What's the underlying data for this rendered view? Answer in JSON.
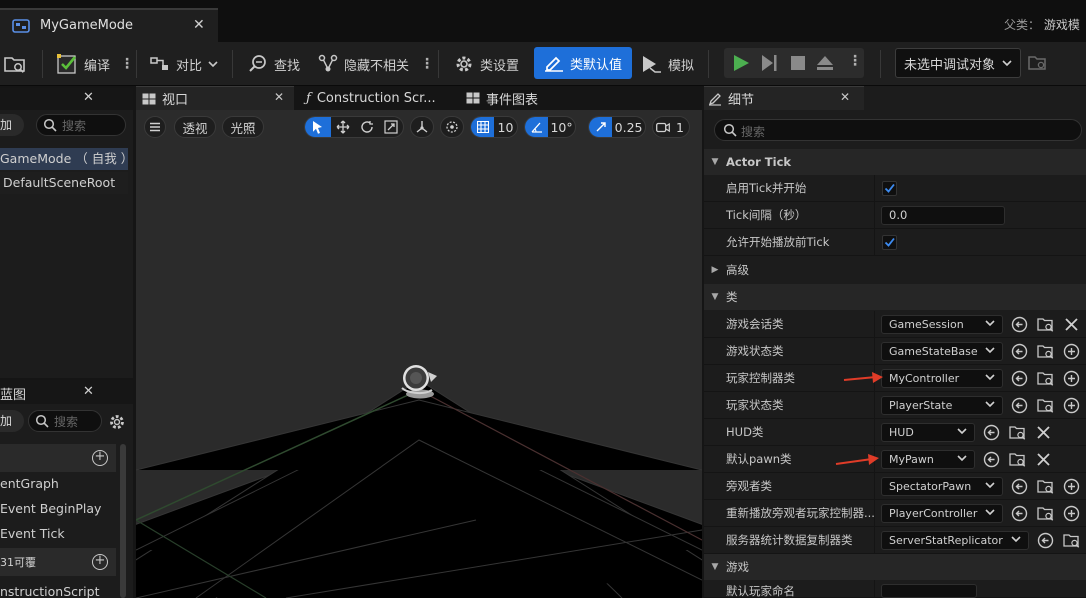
{
  "window": {
    "tab_title": "MyGameMode",
    "parent_label": "父类：",
    "parent_value": "游戏模"
  },
  "toolbar": {
    "compile": "编译",
    "diff": "对比",
    "find": "查找",
    "hide_unrelated": "隐藏不相关",
    "class_settings": "类设置",
    "class_defaults": "类默认值",
    "simulate": "模拟",
    "debug_target": "未选中调试对象"
  },
  "components": {
    "add_label": "加",
    "search_placeholder": "搜索",
    "root_item": "GameMode （ 自我 ）",
    "child_item": "DefaultSceneRoot"
  },
  "blueprint": {
    "title": "蓝图",
    "add_label": "加",
    "search_placeholder": "搜索",
    "items": [
      "entGraph",
      "Event BeginPlay",
      "Event Tick"
    ],
    "section2": "31可覆",
    "construction_item": "nstructionScript"
  },
  "viewport_tabs": {
    "viewport": "视口",
    "construction": "Construction Scr...",
    "event_graph": "事件图表"
  },
  "viewport_toolbar": {
    "perspective": "透视",
    "lit": "光照",
    "grid_size": "10",
    "rotation_snap": "10°",
    "scale_snap": "0.25",
    "camera_speed": "1"
  },
  "details": {
    "title": "细节",
    "search_placeholder": "搜索",
    "cat_actor_tick": "Actor Tick",
    "tick_enabled_label": "启用Tick并开始",
    "tick_enabled": true,
    "tick_interval_label": "Tick间隔（秒）",
    "tick_interval_value": "0.0",
    "tick_before_label": "允许开始播放前Tick",
    "tick_before": true,
    "cat_advanced": "高级",
    "cat_classes": "类",
    "classes": [
      {
        "label": "游戏会话类",
        "value": "GameSession"
      },
      {
        "label": "游戏状态类",
        "value": "GameStateBase"
      },
      {
        "label": "玩家控制器类",
        "value": "MyController",
        "highlighted": true
      },
      {
        "label": "玩家状态类",
        "value": "PlayerState"
      },
      {
        "label": "HUD类",
        "value": "HUD"
      },
      {
        "label": "默认pawn类",
        "value": "MyPawn",
        "highlighted": true
      },
      {
        "label": "旁观者类",
        "value": "SpectatorPawn"
      },
      {
        "label": "重新播放旁观者玩家控制器...",
        "value": "PlayerController"
      },
      {
        "label": "服务器统计数据复制器类",
        "value": "ServerStatReplicator"
      }
    ],
    "cat_game": "游戏",
    "default_player_name_label": "默认玩家命名"
  },
  "colors": {
    "accent": "#1e6fd9",
    "play_green": "#4caf50",
    "arrow_red": "#e03c28"
  }
}
